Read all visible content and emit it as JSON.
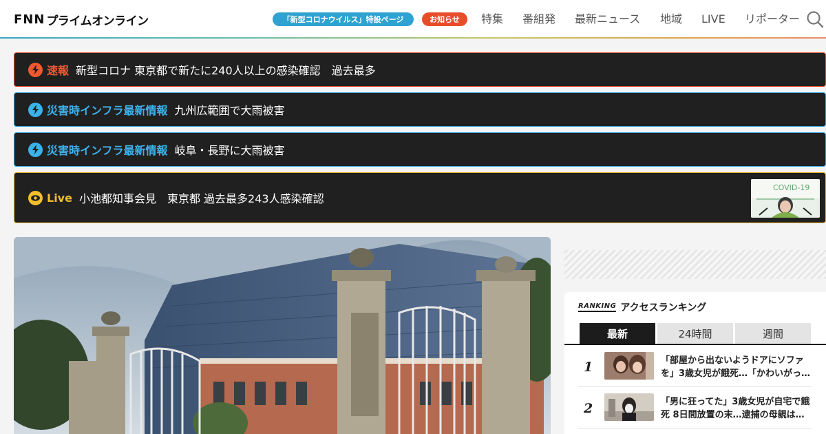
{
  "header": {
    "logo_mark": "FNN",
    "logo_text": "プライムオンライン",
    "covid_pill": "「新型コロナウイルス」特設ページ",
    "notice_pill": "お知らせ",
    "nav": [
      "特集",
      "番組発",
      "最新ニュース",
      "地域",
      "LIVE",
      "リポーター"
    ],
    "search_icon": "search-icon"
  },
  "alerts": [
    {
      "tag": "速報",
      "text": "新型コロナ 東京都で新たに240人以上の感染確認　過去最多",
      "icon": "lightning-icon",
      "color": "#f0592f"
    },
    {
      "tag": "災害時インフラ最新情報",
      "text": "九州広範囲で大雨被害",
      "icon": "lightning-icon",
      "color": "#3db1ea"
    },
    {
      "tag": "災害時インフラ最新情報",
      "text": "岐阜・長野に大雨被害",
      "icon": "lightning-icon",
      "color": "#3db1ea"
    },
    {
      "tag": "Live",
      "text": "小池都知事会見　東京都 過去最多243人感染確認",
      "icon": "eye-icon",
      "color": "#f2be2d"
    }
  ],
  "live_thumb_caption": "COVID-19",
  "ranking": {
    "tag": "RANKING",
    "title": "アクセスランキング",
    "tabs": [
      "最新",
      "24時間",
      "週間"
    ],
    "active_tab": "最新",
    "items": [
      {
        "rank": "1",
        "title": "「部屋から出ないようドアにソファを」3歳女児が餓死…「かわいがっ…"
      },
      {
        "rank": "2",
        "title": "「男に狂ってた」3歳女児が自宅で餓死 8日間放置の末…逮捕の母親は…"
      }
    ]
  }
}
